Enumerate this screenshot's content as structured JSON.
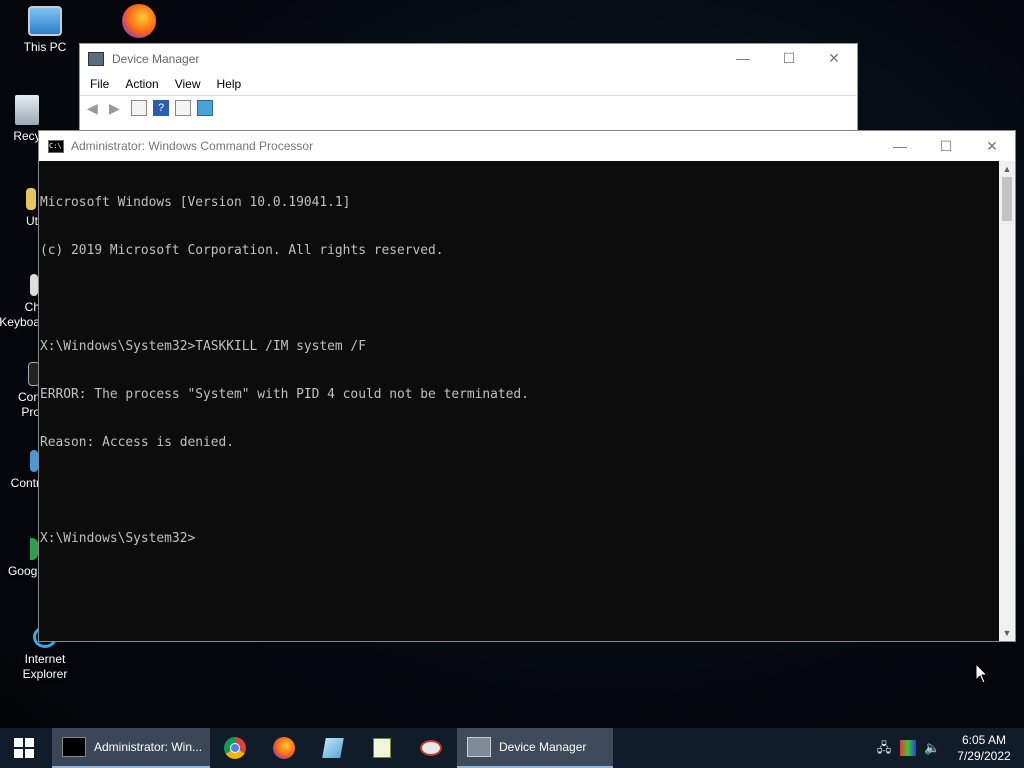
{
  "desktop": {
    "icons": [
      {
        "label": "This PC",
        "icon": "computer-icon"
      },
      {
        "label": "Recy",
        "icon": "recycle-bin-icon"
      },
      {
        "label": "Ut",
        "icon": "folder-icon"
      },
      {
        "label": "Ch",
        "label2": "Keyboa",
        "icon": "keyboard-icon"
      },
      {
        "label": "Con",
        "label2": "Pro",
        "icon": "console-icon"
      },
      {
        "label": "Contr",
        "icon": "control-panel-icon"
      },
      {
        "label": "Googl",
        "icon": "chrome-icon"
      },
      {
        "label": "Internet Explorer",
        "icon": "ie-icon"
      }
    ]
  },
  "device_manager": {
    "title": "Device Manager",
    "menu": [
      "File",
      "Action",
      "View",
      "Help"
    ],
    "controls": {
      "minimize": "—",
      "maximize": "☐",
      "close": "✕"
    }
  },
  "cmd": {
    "title": "Administrator: Windows Command Processor",
    "lines": [
      "Microsoft Windows [Version 10.0.19041.1]",
      "(c) 2019 Microsoft Corporation. All rights reserved.",
      "",
      "X:\\Windows\\System32>TASKKILL /IM system /F",
      "ERROR: The process \"System\" with PID 4 could not be terminated.",
      "Reason: Access is denied.",
      "",
      "X:\\Windows\\System32>"
    ],
    "controls": {
      "minimize": "—",
      "maximize": "☐",
      "close": "✕"
    },
    "scroll": {
      "up": "▲",
      "down": "▼"
    }
  },
  "taskbar": {
    "tasks": [
      {
        "label": "Administrator: Win...",
        "icon": "cmd-icon"
      },
      {
        "label": "Device Manager",
        "icon": "device-manager-icon"
      }
    ],
    "pinned": [
      "chrome-icon",
      "firefox-icon",
      "notepad-icon",
      "editor-icon",
      "paint-icon"
    ],
    "clock": {
      "time": "6:05 AM",
      "date": "7/29/2022"
    }
  },
  "colors": {
    "taskbar": "#101c2a",
    "console_bg": "#0c0c0c",
    "console_fg": "#c0c0c0"
  }
}
